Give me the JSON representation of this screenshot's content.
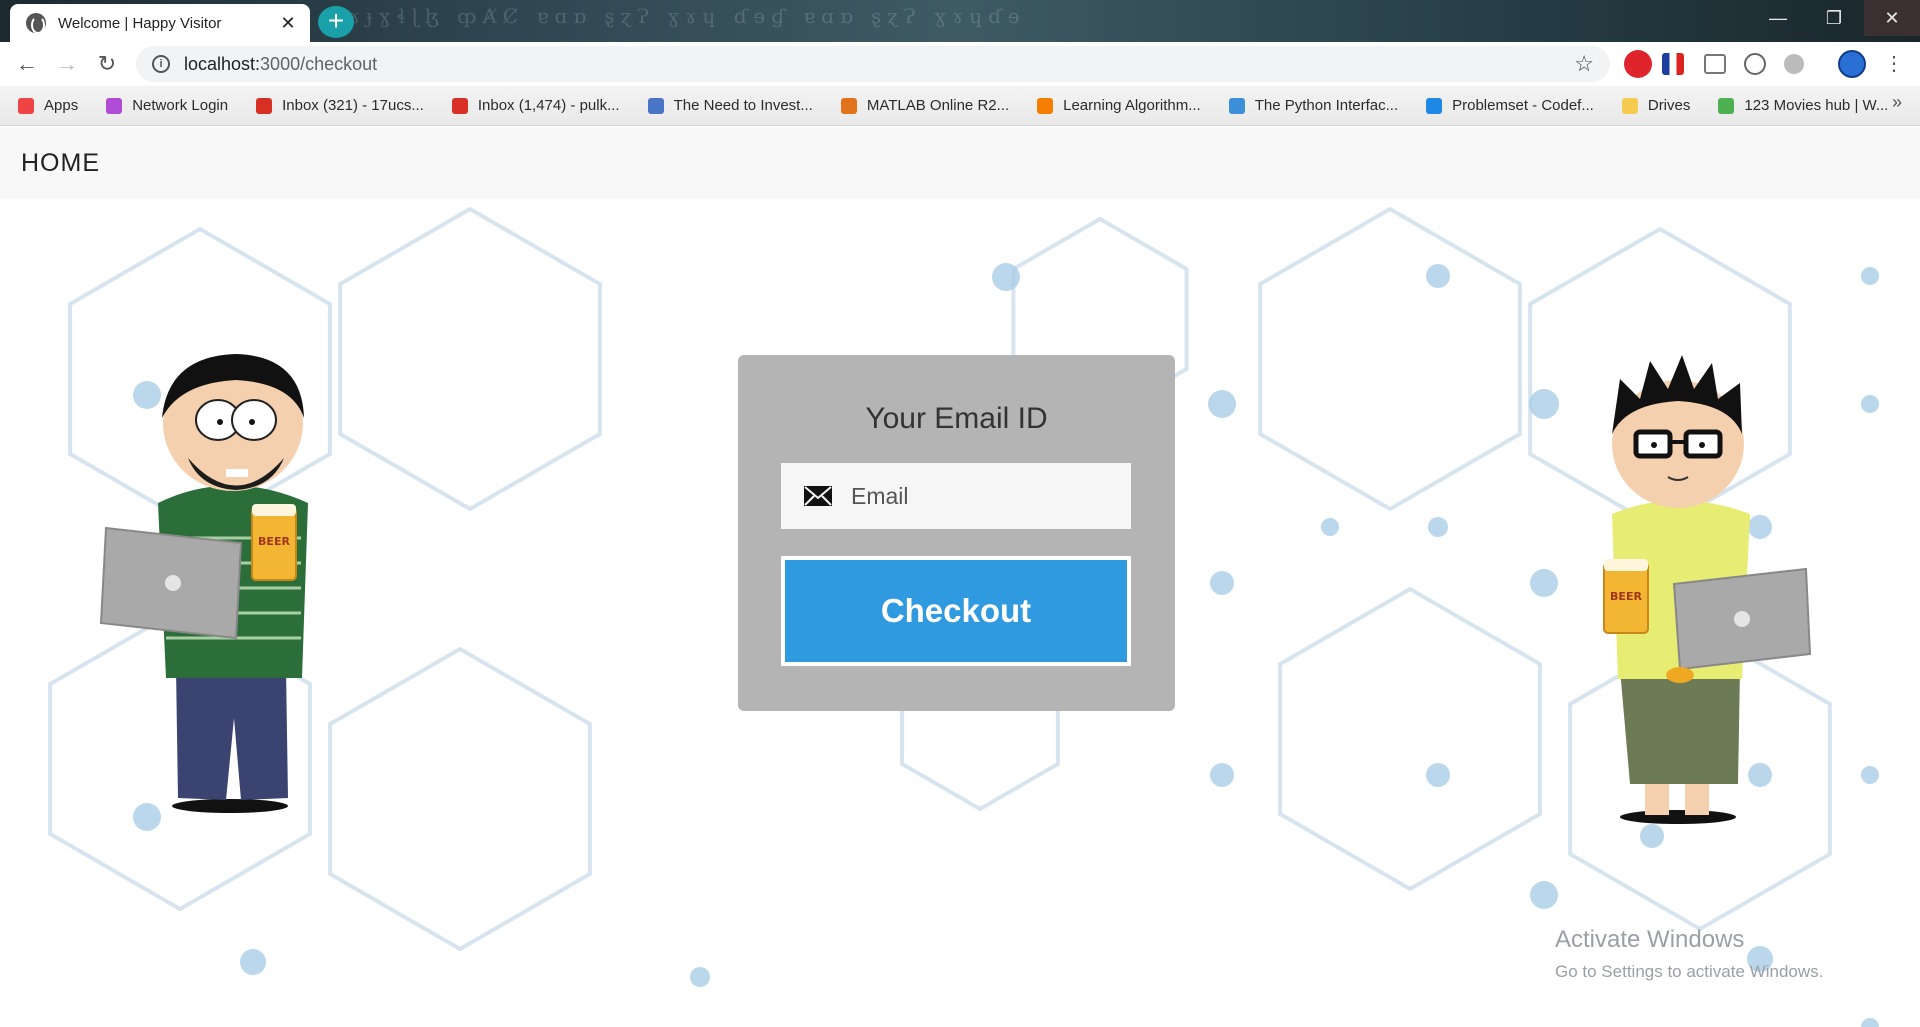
{
  "browser": {
    "tab_title": "Welcome | Happy Visitor",
    "tab_close": "✕",
    "new_tab": "+",
    "window_controls": {
      "minimize": "—",
      "restore": "❐",
      "close": "✕"
    },
    "url_host": "localhost:",
    "url_path": "3000/checkout",
    "star": "☆",
    "bookmarks": [
      {
        "label": "Apps",
        "icon": "apps-grid-icon",
        "color": "#e44"
      },
      {
        "label": "Network Login",
        "icon": "umbrella-icon",
        "color": "#b04bd6"
      },
      {
        "label": "Inbox (321) - 17ucs...",
        "icon": "gmail-icon",
        "color": "#d93025"
      },
      {
        "label": "Inbox (1,474) - pulk...",
        "icon": "gmail-icon",
        "color": "#d93025"
      },
      {
        "label": "The Need to Invest...",
        "icon": "shield-v-icon",
        "color": "#4a76c8"
      },
      {
        "label": "MATLAB Online R2...",
        "icon": "matlab-icon",
        "color": "#e2731d"
      },
      {
        "label": "Learning Algorithm...",
        "icon": "blogger-icon",
        "color": "#f57d00"
      },
      {
        "label": "The Python Interfac...",
        "icon": "shield-icon",
        "color": "#3c8fd8"
      },
      {
        "label": "Problemset - Codef...",
        "icon": "bars-chart-icon",
        "color": "#1e88e5"
      },
      {
        "label": "Drives",
        "icon": "folder-icon",
        "color": "#f6c94f"
      },
      {
        "label": "123 Movies hub | W...",
        "icon": "play-icon",
        "color": "#4caf50"
      }
    ],
    "bookmarks_more": "»"
  },
  "page": {
    "brand": "HOME",
    "form": {
      "heading": "Your Email ID",
      "email_placeholder": "Email",
      "email_value": "",
      "submit_label": "Checkout"
    },
    "watermark": {
      "line1": "Activate Windows",
      "line2": "Go to Settings to activate Windows."
    },
    "characters": [
      {
        "name": "left-character",
        "description": "cartoon man with laptop and beer"
      },
      {
        "name": "right-character",
        "description": "cartoon man with glasses, laptop and beer"
      }
    ],
    "beer_label": "BEER",
    "colors": {
      "accent": "#2f9ae0",
      "card_bg": "#b4b4b5",
      "hex_lines": "#c9dbe9",
      "hex_dots": "#a9cde6"
    }
  }
}
